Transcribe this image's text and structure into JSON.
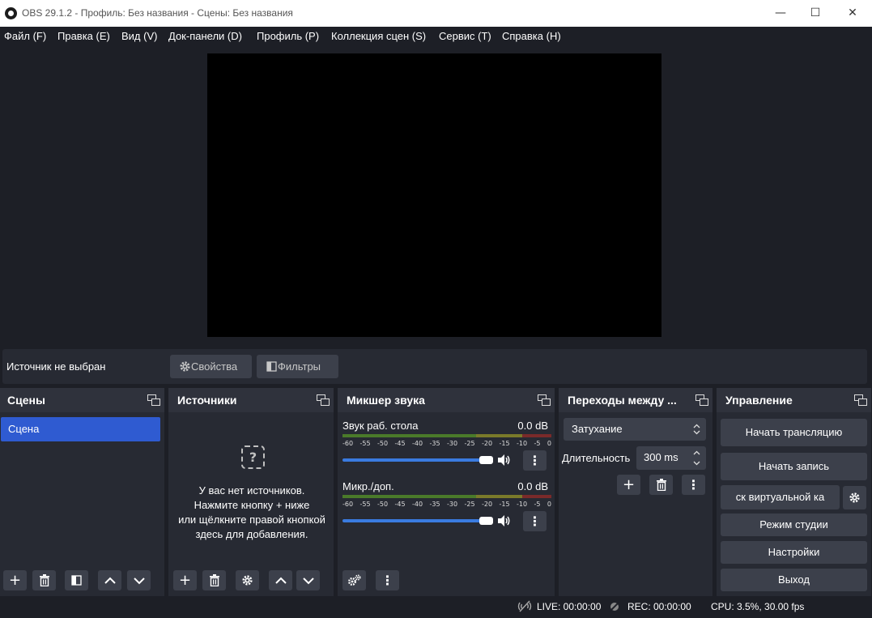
{
  "window": {
    "title": "OBS 29.1.2 - Профиль: Без названия - Сцены: Без названия",
    "minimize": "—",
    "maximize": "☐",
    "close": "✕"
  },
  "menu": [
    "Файл (F)",
    "Правка (E)",
    "Вид (V)",
    "Док-панели (D)",
    "Профиль (P)",
    "Коллекция сцен (S)",
    "Сервис (T)",
    "Справка (H)"
  ],
  "source_bar": {
    "no_source": "Источник не выбран",
    "properties": "Свойства",
    "filters": "Фильтры"
  },
  "scenes": {
    "title": "Сцены",
    "items": [
      "Сцена"
    ]
  },
  "sources": {
    "title": "Источники",
    "empty_line1": "У вас нет источников.",
    "empty_line2": "Нажмите кнопку + ниже",
    "empty_line3": "или щёлкните правой кнопкой",
    "empty_line4": "здесь для добавления.",
    "empty_icon": "?"
  },
  "mixer": {
    "title": "Микшер звука",
    "ticks": [
      "-60",
      "-55",
      "-50",
      "-45",
      "-40",
      "-35",
      "-30",
      "-25",
      "-20",
      "-15",
      "-10",
      "-5",
      "0"
    ],
    "channels": [
      {
        "name": "Звук раб. стола",
        "db": "0.0 dB",
        "volume": 1.0
      },
      {
        "name": "Микр./доп.",
        "db": "0.0 dB",
        "volume": 1.0
      }
    ]
  },
  "transitions": {
    "title": "Переходы между ...",
    "selected": "Затухание",
    "duration_label": "Длительность",
    "duration_value": "300 ms"
  },
  "controls": {
    "title": "Управление",
    "start_stream": "Начать трансляцию",
    "start_record": "Начать запись",
    "virtual_cam": "ск виртуальной ка",
    "studio_mode": "Режим студии",
    "settings": "Настройки",
    "exit": "Выход"
  },
  "status": {
    "live": "LIVE: 00:00:00",
    "rec": "REC: 00:00:00",
    "cpu": "CPU: 3.5%, 30.00 fps"
  }
}
